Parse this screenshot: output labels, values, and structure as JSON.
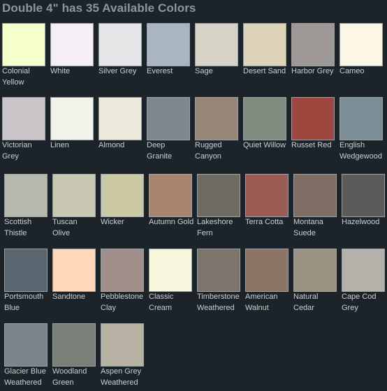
{
  "title": "Double 4\" has 35 Available Colors",
  "colors": [
    {
      "name": "Colonial\nYellow",
      "hex": "#f5ffcc"
    },
    {
      "name": "White",
      "hex": "#f5eef5"
    },
    {
      "name": "Silver Grey",
      "hex": "#e6e5e8"
    },
    {
      "name": "Everest",
      "hex": "#a9b5c0"
    },
    {
      "name": "Sage",
      "hex": "#d6d2c5"
    },
    {
      "name": "Desert Sand",
      "hex": "#dcd3b8"
    },
    {
      "name": "Harbor Grey",
      "hex": "#9d9895"
    },
    {
      "name": "Cameo",
      "hex": "#fcf6e6"
    },
    {
      "name": "Victorian\nGrey",
      "hex": "#c8c4c8"
    },
    {
      "name": "Linen",
      "hex": "#f3f2ea"
    },
    {
      "name": "Almond",
      "hex": "#ede9da"
    },
    {
      "name": "Deep\nGranite",
      "hex": "#7d888d"
    },
    {
      "name": "Rugged\nCanyon",
      "hex": "#978575"
    },
    {
      "name": "Quiet Willow",
      "hex": "#7f8c7f"
    },
    {
      "name": "Russet Red",
      "hex": "#9d473f"
    },
    {
      "name": "English\nWedgewood",
      "hex": "#7d8e96"
    },
    {
      "name": "Scottish\nThistle",
      "hex": "#b6b9ad"
    },
    {
      "name": "Tuscan\nOlive",
      "hex": "#c8c8b2"
    },
    {
      "name": "Wicker",
      "hex": "#cbc8a4"
    },
    {
      "name": "Autumn Gold",
      "hex": "#a8836d"
    },
    {
      "name": "Lakeshore\nFern",
      "hex": "#6e6a62"
    },
    {
      "name": "Terra Cotta",
      "hex": "#9b5c55"
    },
    {
      "name": "Montana\nSuede",
      "hex": "#7e6d62"
    },
    {
      "name": "Hazelwood",
      "hex": "#5b5b59"
    },
    {
      "name": "Portsmouth\nBlue",
      "hex": "#596670"
    },
    {
      "name": "Sandtone",
      "hex": "#ffd8b9"
    },
    {
      "name": "Pebblestone\nClay",
      "hex": "#a08f8b"
    },
    {
      "name": "Classic\nCream",
      "hex": "#f6f7dd"
    },
    {
      "name": "Timberstone\nWeathered",
      "hex": "#7e756c"
    },
    {
      "name": "American\nWalnut",
      "hex": "#8c7564"
    },
    {
      "name": "Natural\nCedar",
      "hex": "#9a9283"
    },
    {
      "name": "Cape Cod\nGrey",
      "hex": "#b3b1a9"
    },
    {
      "name": "Glacier Blue\nWeathered",
      "hex": "#7b848b"
    },
    {
      "name": "Woodland\nGreen",
      "hex": "#7a7f78"
    },
    {
      "name": "Aspen Grey\nWeathered",
      "hex": "#b8b2a5"
    }
  ]
}
